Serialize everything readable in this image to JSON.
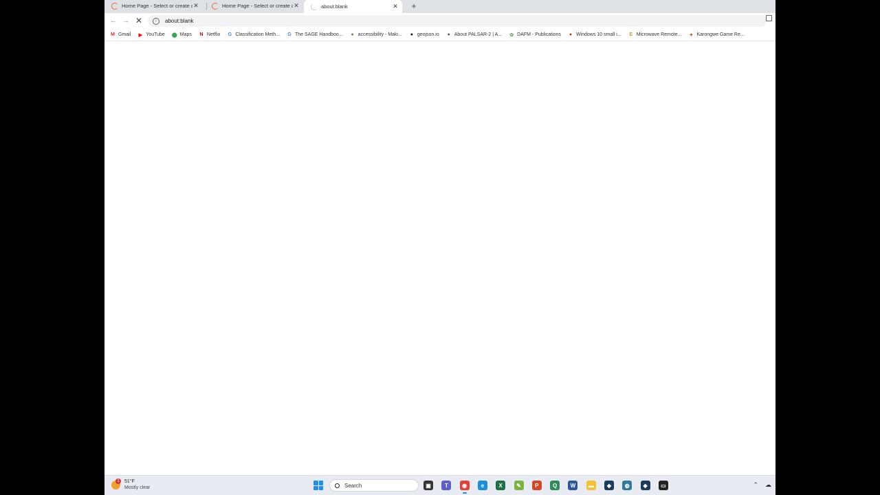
{
  "browser": {
    "tabs": [
      {
        "title": "Home Page - Select or create a",
        "close": "✕",
        "state": "inactive"
      },
      {
        "title": "Home Page - Select or create a",
        "close": "✕",
        "state": "inactive"
      },
      {
        "title": "about:blank",
        "close": "✕",
        "state": "active"
      }
    ],
    "new_tab": "+",
    "nav": {
      "back": "←",
      "forward": "→",
      "stop": "✕"
    },
    "omnibox": {
      "info": "i",
      "url": "about:blank"
    },
    "bookmarks": [
      {
        "label": "Gmail",
        "icon": "gmail-icon",
        "glyph": "M",
        "color": "#d93025"
      },
      {
        "label": "YouTube",
        "icon": "youtube-icon",
        "glyph": "▶",
        "color": "#ff0000"
      },
      {
        "label": "Maps",
        "icon": "maps-icon",
        "glyph": "⬤",
        "color": "#34a853"
      },
      {
        "label": "Netflix",
        "icon": "netflix-icon",
        "glyph": "N",
        "color": "#b20710"
      },
      {
        "label": "Classification Meth...",
        "icon": "google-icon",
        "glyph": "G",
        "color": "#4285f4"
      },
      {
        "label": "The SAGE Handboo...",
        "icon": "google-icon",
        "glyph": "G",
        "color": "#4285f4"
      },
      {
        "label": "accessibility - Maki...",
        "icon": "site-icon",
        "glyph": "●",
        "color": "#8a6d4b"
      },
      {
        "label": "geojson.io",
        "icon": "geojson-icon",
        "glyph": "●",
        "color": "#111111"
      },
      {
        "label": "About PALSAR-2 | A...",
        "icon": "globe-icon",
        "glyph": "●",
        "color": "#555555"
      },
      {
        "label": "DAFM - Publications",
        "icon": "dafm-icon",
        "glyph": "✿",
        "color": "#7aa06a"
      },
      {
        "label": "Windows 10 small i...",
        "icon": "site-icon",
        "glyph": "●",
        "color": "#c0392b"
      },
      {
        "label": "Microwave Remote...",
        "icon": "e-icon",
        "glyph": "E",
        "color": "#c8a030"
      },
      {
        "label": "Karongwe Game Re...",
        "icon": "site-icon",
        "glyph": "✦",
        "color": "#a06030"
      }
    ]
  },
  "taskbar": {
    "weather": {
      "badge": "1",
      "temp": "51°F",
      "desc": "Mostly clear"
    },
    "search_label": "Search",
    "apps": [
      {
        "name": "task-view-icon",
        "glyph": "▣",
        "color": "#333333"
      },
      {
        "name": "teams-icon",
        "glyph": "T",
        "color": "#5b5fc7"
      },
      {
        "name": "chrome-icon",
        "glyph": "◉",
        "color": "#e34133"
      },
      {
        "name": "edge-icon",
        "glyph": "e",
        "color": "#1a8fd6"
      },
      {
        "name": "excel-icon",
        "glyph": "X",
        "color": "#1d7044"
      },
      {
        "name": "notepadpp-icon",
        "glyph": "✎",
        "color": "#7cb342"
      },
      {
        "name": "powerpoint-icon",
        "glyph": "P",
        "color": "#d24726"
      },
      {
        "name": "qgis-icon",
        "glyph": "Q",
        "color": "#2e8b57"
      },
      {
        "name": "word-icon",
        "glyph": "W",
        "color": "#2b579a"
      },
      {
        "name": "file-explorer-icon",
        "glyph": "▬",
        "color": "#f2c233"
      },
      {
        "name": "app-icon",
        "glyph": "◆",
        "color": "#1b3a5c"
      },
      {
        "name": "globe-app-icon",
        "glyph": "◍",
        "color": "#2f7a9a"
      },
      {
        "name": "app-icon-2",
        "glyph": "◆",
        "color": "#1b3a5c"
      },
      {
        "name": "terminal-icon",
        "glyph": "▭",
        "color": "#222222"
      }
    ],
    "tray": {
      "chevron": "⌃",
      "cloud": "☁"
    }
  }
}
